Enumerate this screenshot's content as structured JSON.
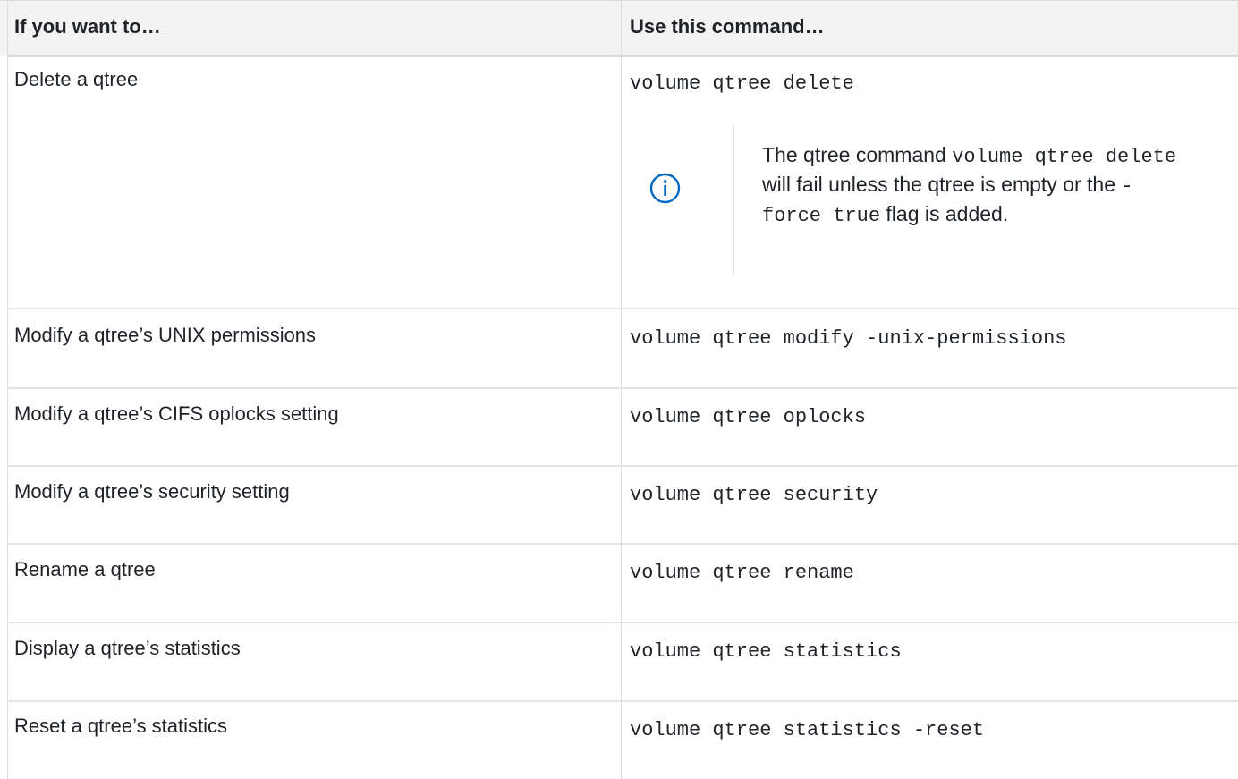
{
  "table": {
    "headers": {
      "task": "If you want to…",
      "command": "Use this command…"
    },
    "rows": [
      {
        "task": "Delete a qtree",
        "command": "volume qtree delete"
      },
      {
        "task": "Modify a qtree’s UNIX permissions",
        "command": "volume qtree modify -unix-permissions"
      },
      {
        "task": "Modify a qtree’s CIFS oplocks setting",
        "command": "volume qtree oplocks"
      },
      {
        "task": "Modify a qtree’s security setting",
        "command": "volume qtree security"
      },
      {
        "task": "Rename a qtree",
        "command": "volume qtree rename"
      },
      {
        "task": "Display a qtree’s statistics",
        "command": "volume qtree statistics"
      },
      {
        "task": "Reset a qtree’s statistics",
        "command": "volume qtree statistics -reset"
      }
    ]
  },
  "note": {
    "icon": "info-icon",
    "text_1": "The qtree command ",
    "code_1": "volume qtree delete",
    "text_2": " will fail unless the qtree is empty or the ",
    "code_2": "-force true",
    "text_3": " flag is added."
  },
  "colors": {
    "text": "#1f2328",
    "header_bg": "#f3f3f3",
    "border": "#dcdcdc",
    "info_icon": "#0067c5"
  }
}
